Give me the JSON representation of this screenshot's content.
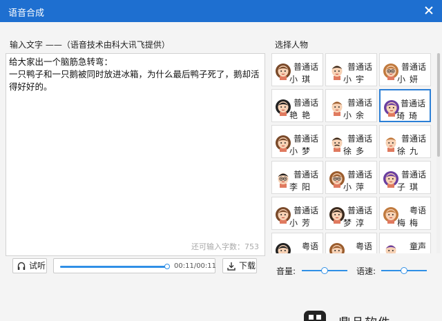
{
  "window": {
    "title": "语音合成"
  },
  "colors": {
    "titlebar": "#1e6fd0",
    "accent": "#2f8fe6",
    "selected_border": "#2b7fd6"
  },
  "input": {
    "label": "输入文字 ——（语音技术由科大讯飞提供）",
    "text_line1": "给大家出一个脑筋急转弯：",
    "text_line2": "一只鸭子和一只鹅被同时放进冰箱，为什么最后鸭子死了，鹅却活得好好的。",
    "remaining": "还可输入字数：753"
  },
  "player": {
    "listen_label": "试听",
    "download_label": "下载",
    "time": "00:11/00:11",
    "progress": 1.0
  },
  "voices": {
    "label": "选择人物",
    "items": [
      {
        "lang": "普通话",
        "name": "小琪",
        "avatar": "girl-avatar-icon",
        "selected": false
      },
      {
        "lang": "普通话",
        "name": "小宇",
        "avatar": "boy-avatar-icon",
        "selected": false
      },
      {
        "lang": "普通话",
        "name": "小妍",
        "avatar": "girl-glasses-avatar-icon",
        "selected": false
      },
      {
        "lang": "普通话",
        "name": "艳艳",
        "avatar": "girl-avatar-icon",
        "selected": false
      },
      {
        "lang": "普通话",
        "name": "小余",
        "avatar": "boy-avatar-icon",
        "selected": false
      },
      {
        "lang": "普通话",
        "name": "琦琦",
        "avatar": "girl-avatar-icon",
        "selected": true
      },
      {
        "lang": "普通话",
        "name": "小梦",
        "avatar": "girl-avatar-icon",
        "selected": false
      },
      {
        "lang": "普通话",
        "name": "徐多",
        "avatar": "man-mustache-avatar-icon",
        "selected": false
      },
      {
        "lang": "普通话",
        "name": "徐九",
        "avatar": "boy-avatar-icon",
        "selected": false
      },
      {
        "lang": "普通话",
        "name": "李阳",
        "avatar": "boy-glasses-avatar-icon",
        "selected": false
      },
      {
        "lang": "普通话",
        "name": "小萍",
        "avatar": "girl-glasses-avatar-icon",
        "selected": false
      },
      {
        "lang": "普通话",
        "name": "子琪",
        "avatar": "girl-avatar-icon",
        "selected": false
      },
      {
        "lang": "普通话",
        "name": "小芳",
        "avatar": "girl-avatar-icon",
        "selected": false
      },
      {
        "lang": "普通话",
        "name": "梦淳",
        "avatar": "girl-avatar-icon",
        "selected": false
      },
      {
        "lang": "粤语",
        "name": "梅梅",
        "avatar": "girl-avatar-icon",
        "selected": false
      },
      {
        "lang": "粤语",
        "name": "",
        "avatar": "girl-avatar-icon",
        "selected": false
      },
      {
        "lang": "粤语",
        "name": "",
        "avatar": "girl-avatar-icon",
        "selected": false
      },
      {
        "lang": "童声",
        "name": "",
        "avatar": "boy-avatar-icon",
        "selected": false
      }
    ]
  },
  "controls": {
    "volume_label": "音量:",
    "speed_label": "语速:",
    "volume_level": 0.5,
    "speed_level": 0.5
  },
  "watermark": {
    "brand": "鼎品软件"
  }
}
